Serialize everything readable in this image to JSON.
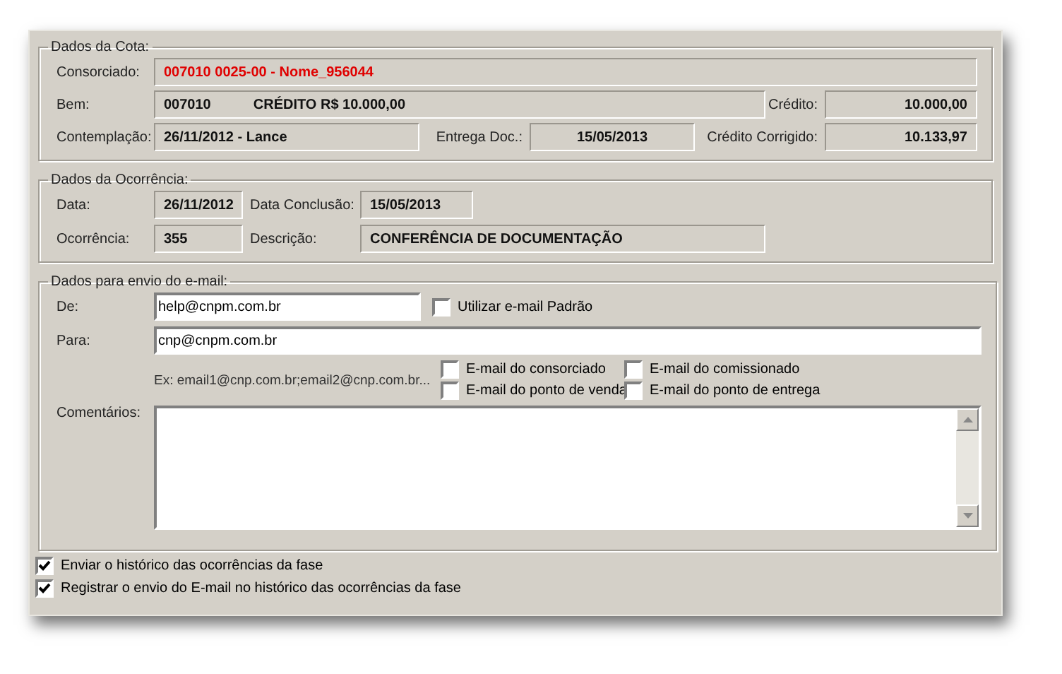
{
  "dados_da_cota": {
    "title": "Dados da Cota:",
    "consorciado": {
      "label": "Consorciado:",
      "value": "007010 0025-00 - Nome_956044"
    },
    "bem": {
      "label": "Bem:",
      "code": "007010",
      "description": "CRÉDITO R$ 10.000,00"
    },
    "credito": {
      "label": "Crédito:",
      "value": "10.000,00"
    },
    "contemplacao": {
      "label": "Contemplação:",
      "value": "26/11/2012 - Lance"
    },
    "entrega_doc": {
      "label": "Entrega Doc.:",
      "value": "15/05/2013"
    },
    "credito_corrigido": {
      "label": "Crédito Corrigido:",
      "value": "10.133,97"
    }
  },
  "dados_da_ocorrencia": {
    "title": "Dados da Ocorrência:",
    "data": {
      "label": "Data:",
      "value": "26/11/2012"
    },
    "data_conclusao": {
      "label": "Data Conclusão:",
      "value": "15/05/2013"
    },
    "ocorrencia": {
      "label": "Ocorrência:",
      "value": "355"
    },
    "descricao": {
      "label": "Descrição:",
      "value": "CONFERÊNCIA DE DOCUMENTAÇÃO"
    }
  },
  "dados_email": {
    "title": "Dados para envio do e-mail:",
    "de": {
      "label": "De:",
      "value": "help@cnpm.com.br"
    },
    "usar_padrao": {
      "label": "Utilizar e-mail Padrão",
      "checked": false
    },
    "para": {
      "label": "Para:",
      "value": "cnp@cnpm.com.br"
    },
    "hint": "Ex: email1@cnp.com.br;email2@cnp.com.br...",
    "options": [
      {
        "label": "E-mail do consorciado",
        "checked": false
      },
      {
        "label": "E-mail do comissionado",
        "checked": false
      },
      {
        "label": "E-mail do ponto de venda",
        "checked": false
      },
      {
        "label": "E-mail do ponto de entrega",
        "checked": false
      }
    ],
    "comentarios": {
      "label": "Comentários:"
    }
  },
  "bottom_options": [
    {
      "label": "Enviar o histórico das ocorrências da fase",
      "checked": true
    },
    {
      "label": "Registrar o envio do E-mail no histórico das ocorrências da fase",
      "checked": true
    }
  ]
}
